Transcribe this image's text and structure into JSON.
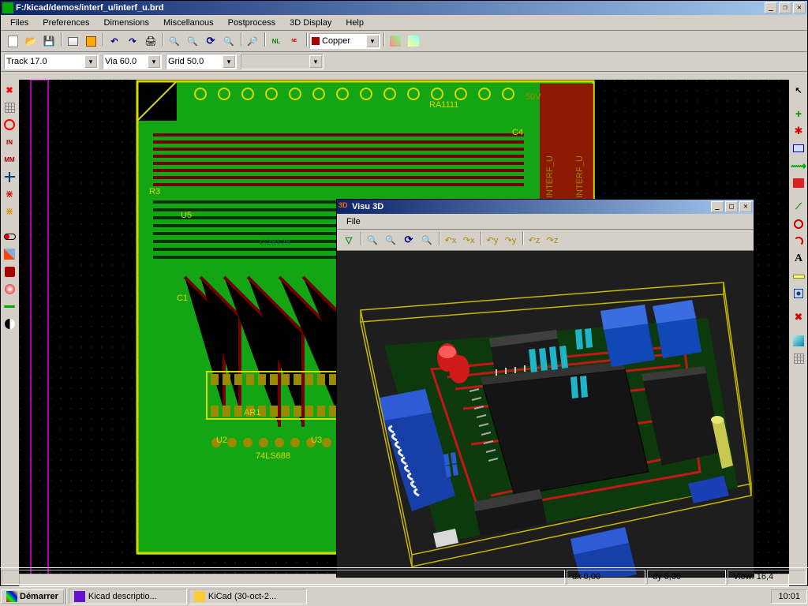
{
  "main_window": {
    "title": "F:/kicad/demos/interf_u/interf_u.brd",
    "menus": [
      "Files",
      "Preferences",
      "Dimensions",
      "Miscellanous",
      "Postprocess",
      "3D Display",
      "Help"
    ],
    "layer_combo": "Copper",
    "track_combo": "Track 17.0",
    "via_combo": "Via 60.0",
    "grid_combo": "Grid 50.0"
  },
  "pcb": {
    "board_label1": "INTERF_U",
    "board_label2": "INTERF_U",
    "voltage": "50V",
    "refs": [
      "R3",
      "U5",
      "C4",
      "RA1111",
      "C1",
      "G28128",
      "AR1",
      "U2",
      "U3",
      "74LS688"
    ]
  },
  "viewer3d": {
    "title": "Visu 3D",
    "menus": [
      "File"
    ]
  },
  "statusbar": {
    "dx": "dx 0,00",
    "dy": "dy 0,00",
    "view": "View: 16,4"
  },
  "taskbar": {
    "start": "Démarrer",
    "tasks": [
      "Kicad descriptio...",
      "KiCad (30-oct-2..."
    ],
    "clock": "10:01"
  }
}
